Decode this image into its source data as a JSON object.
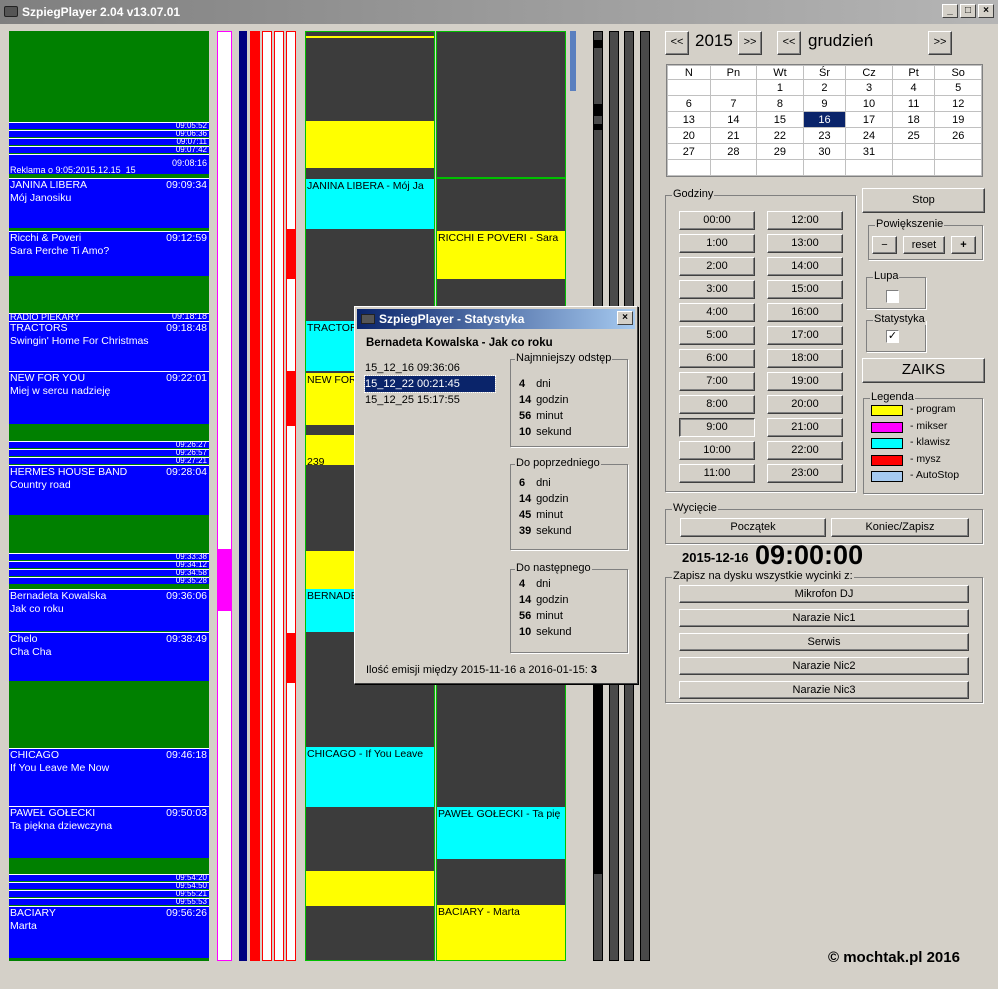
{
  "window": {
    "title": "SzpiegPlayer 2.04 v13.07.01",
    "btn_min": "_",
    "btn_max": "□",
    "btn_close": "×"
  },
  "songs": [
    {
      "artist": "JANINA LIBERA",
      "title": "Mój Janosiku",
      "time": "09:09:34"
    },
    {
      "artist": "Ricchi & Poveri",
      "title": "Sara Perche Ti Amo?",
      "time": "09:12:59"
    },
    {
      "artist": "TRACTORS",
      "title": "Swingin' Home For Christmas",
      "time": "09:18:48"
    },
    {
      "artist": "NEW FOR YOU",
      "title": "Miej w sercu nadzieję",
      "time": "09:22:01"
    },
    {
      "artist": "HERMES HOUSE BAND",
      "title": "Country road",
      "time": "09:28:04"
    },
    {
      "artist": "Bernadeta Kowalska",
      "title": "Jak co roku",
      "time": "09:36:06"
    },
    {
      "artist": "Chelo",
      "title": "Cha Cha",
      "time": "09:38:49"
    },
    {
      "artist": "CHICAGO",
      "title": "If You Leave Me Now",
      "time": "09:46:18"
    },
    {
      "artist": "PAWEŁ GOŁECKI",
      "title": "Ta piękna dziewczyna",
      "time": "09:50:03"
    },
    {
      "artist": "BACIARY",
      "title": "Marta",
      "time": "09:56:26"
    }
  ],
  "thin_entries": {
    "a1": "09:05:52",
    "a2": "09:06:36",
    "a3": "09:07:11",
    "a4": "09:07:42",
    "a5": "09:08:16",
    "reklama": "Reklama o 9:05:2015.12.15_15",
    "radio": "RADIO PIEKARY",
    "radio_time": "09:18:18",
    "b1": "09:26:27",
    "b2": "09:26:57",
    "b3": "09:27:21",
    "c1": "09:33:38",
    "c2": "09:34:12",
    "c3": "09:34:58",
    "c4": "09:35:28",
    "d1": "09:54:20",
    "d2": "09:54:50",
    "d3": "09:55:21",
    "d4": "09:55:53"
  },
  "lane_labels": {
    "col1_janina": "JANINA LIBERA - Mój Ja",
    "col1_tractor": "TRACTOR",
    "col1_newfor": "NEW FOR",
    "col1_239": "239",
    "col1_bernadet": "BERNADET",
    "col1_chicago": "CHICAGO - If You Leave",
    "col2_ricchi": "RICCHI E POVERI - Sara",
    "col2_golecki": "PAWEŁ GOŁECKI - Ta pię",
    "col2_baciary": "BACIARY - Marta"
  },
  "calendar": {
    "year": "2015",
    "month": "grudzień",
    "prev": "<<",
    "next": ">>",
    "days": [
      "N",
      "Pn",
      "Wt",
      "Śr",
      "Cz",
      "Pt",
      "So"
    ],
    "weeks": [
      [
        "",
        "",
        "1",
        "2",
        "3",
        "4",
        "5"
      ],
      [
        "6",
        "7",
        "8",
        "9",
        "10",
        "11",
        "12"
      ],
      [
        "13",
        "14",
        "15",
        "16",
        "17",
        "18",
        "19"
      ],
      [
        "20",
        "21",
        "22",
        "23",
        "24",
        "25",
        "26"
      ],
      [
        "27",
        "28",
        "29",
        "30",
        "31",
        "",
        ""
      ],
      [
        "",
        "",
        "",
        "",
        "",
        "",
        ""
      ]
    ],
    "selected": "16"
  },
  "hours": {
    "label": "Godziny",
    "left": [
      "00:00",
      "1:00",
      "2:00",
      "3:00",
      "4:00",
      "5:00",
      "6:00",
      "7:00",
      "8:00",
      "9:00",
      "10:00",
      "11:00"
    ],
    "right": [
      "12:00",
      "13:00",
      "14:00",
      "15:00",
      "16:00",
      "17:00",
      "18:00",
      "19:00",
      "20:00",
      "21:00",
      "22:00",
      "23:00"
    ],
    "active": "9:00"
  },
  "controls": {
    "stop": "Stop",
    "zoom_label": "Powiększenie",
    "zoom_minus": "−",
    "zoom_reset": "reset",
    "zoom_plus": "+",
    "lupa_label": "Lupa",
    "stats_label": "Statystyka",
    "stats_check": "✓",
    "zaiks": "ZAIKS"
  },
  "legend": {
    "label": "Legenda",
    "items": [
      {
        "name": "- program",
        "color": "#ffff00"
      },
      {
        "name": "- mikser",
        "color": "#ff00ff"
      },
      {
        "name": "- klawisz",
        "color": "#00ffff"
      },
      {
        "name": "- mysz",
        "color": "#ff0000"
      },
      {
        "name": "- AutoStop",
        "color": "#a6caf0"
      }
    ]
  },
  "cut": {
    "label": "Wycięcie",
    "start": "Początek",
    "end": "Koniec/Zapisz"
  },
  "clock": {
    "date": "2015-12-16",
    "time": "09:00:00"
  },
  "save": {
    "label": "Zapisz na dysku wszystkie wycinki z:",
    "buttons": [
      "Mikrofon DJ",
      "Narazie Nic1",
      "Serwis",
      "Narazie Nic2",
      "Narazie Nic3"
    ]
  },
  "stats_dialog": {
    "title": "SzpiegPlayer - Statystyka",
    "song": "Bernadeta Kowalska - Jak co roku",
    "dates": [
      "15_12_16 09:36:06",
      "15_12_22 00:21:45",
      "15_12_25 15:17:55"
    ],
    "selected_index": 1,
    "min_gap": {
      "label": "Najmniejszy odstęp",
      "days": "4",
      "hours": "14",
      "minutes": "56",
      "seconds": "10"
    },
    "prev": {
      "label": "Do poprzedniego",
      "days": "6",
      "hours": "14",
      "minutes": "45",
      "seconds": "39"
    },
    "next": {
      "label": "Do następnego",
      "days": "4",
      "hours": "14",
      "minutes": "56",
      "seconds": "10"
    },
    "units": {
      "d": "dni",
      "h": "godzin",
      "m": "minut",
      "s": "sekund"
    },
    "count_text": "Ilość emisji między 2015-11-16 a 2016-01-15:",
    "count": "3",
    "close": "×"
  },
  "copyright": "© mochtak.pl 2016"
}
